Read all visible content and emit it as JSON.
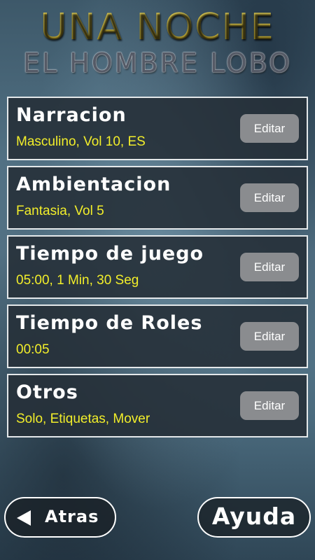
{
  "header": {
    "title_line1": "UNA NOCHE",
    "title_line2": "EL HOMBRE LOBO"
  },
  "settings": [
    {
      "title": "Narracion",
      "value": "Masculino, Vol 10, ES",
      "button": "Editar"
    },
    {
      "title": "Ambientacion",
      "value": "Fantasia, Vol 5",
      "button": "Editar"
    },
    {
      "title": "Tiempo de juego",
      "value": "05:00, 1 Min, 30 Seg",
      "button": "Editar"
    },
    {
      "title": "Tiempo de Roles",
      "value": "00:05",
      "button": "Editar"
    },
    {
      "title": "Otros",
      "value": "Solo, Etiquetas, Mover",
      "button": "Editar"
    }
  ],
  "footer": {
    "back_label": "Atras",
    "help_label": "Ayuda"
  },
  "colors": {
    "card_background": "#263038",
    "card_border": "#e4e8ea",
    "value_text": "#f2ee2a",
    "edit_button": "#8a8c8f",
    "title_gold": "#c9b23c"
  },
  "icons": {
    "back": "left-triangle-icon"
  }
}
